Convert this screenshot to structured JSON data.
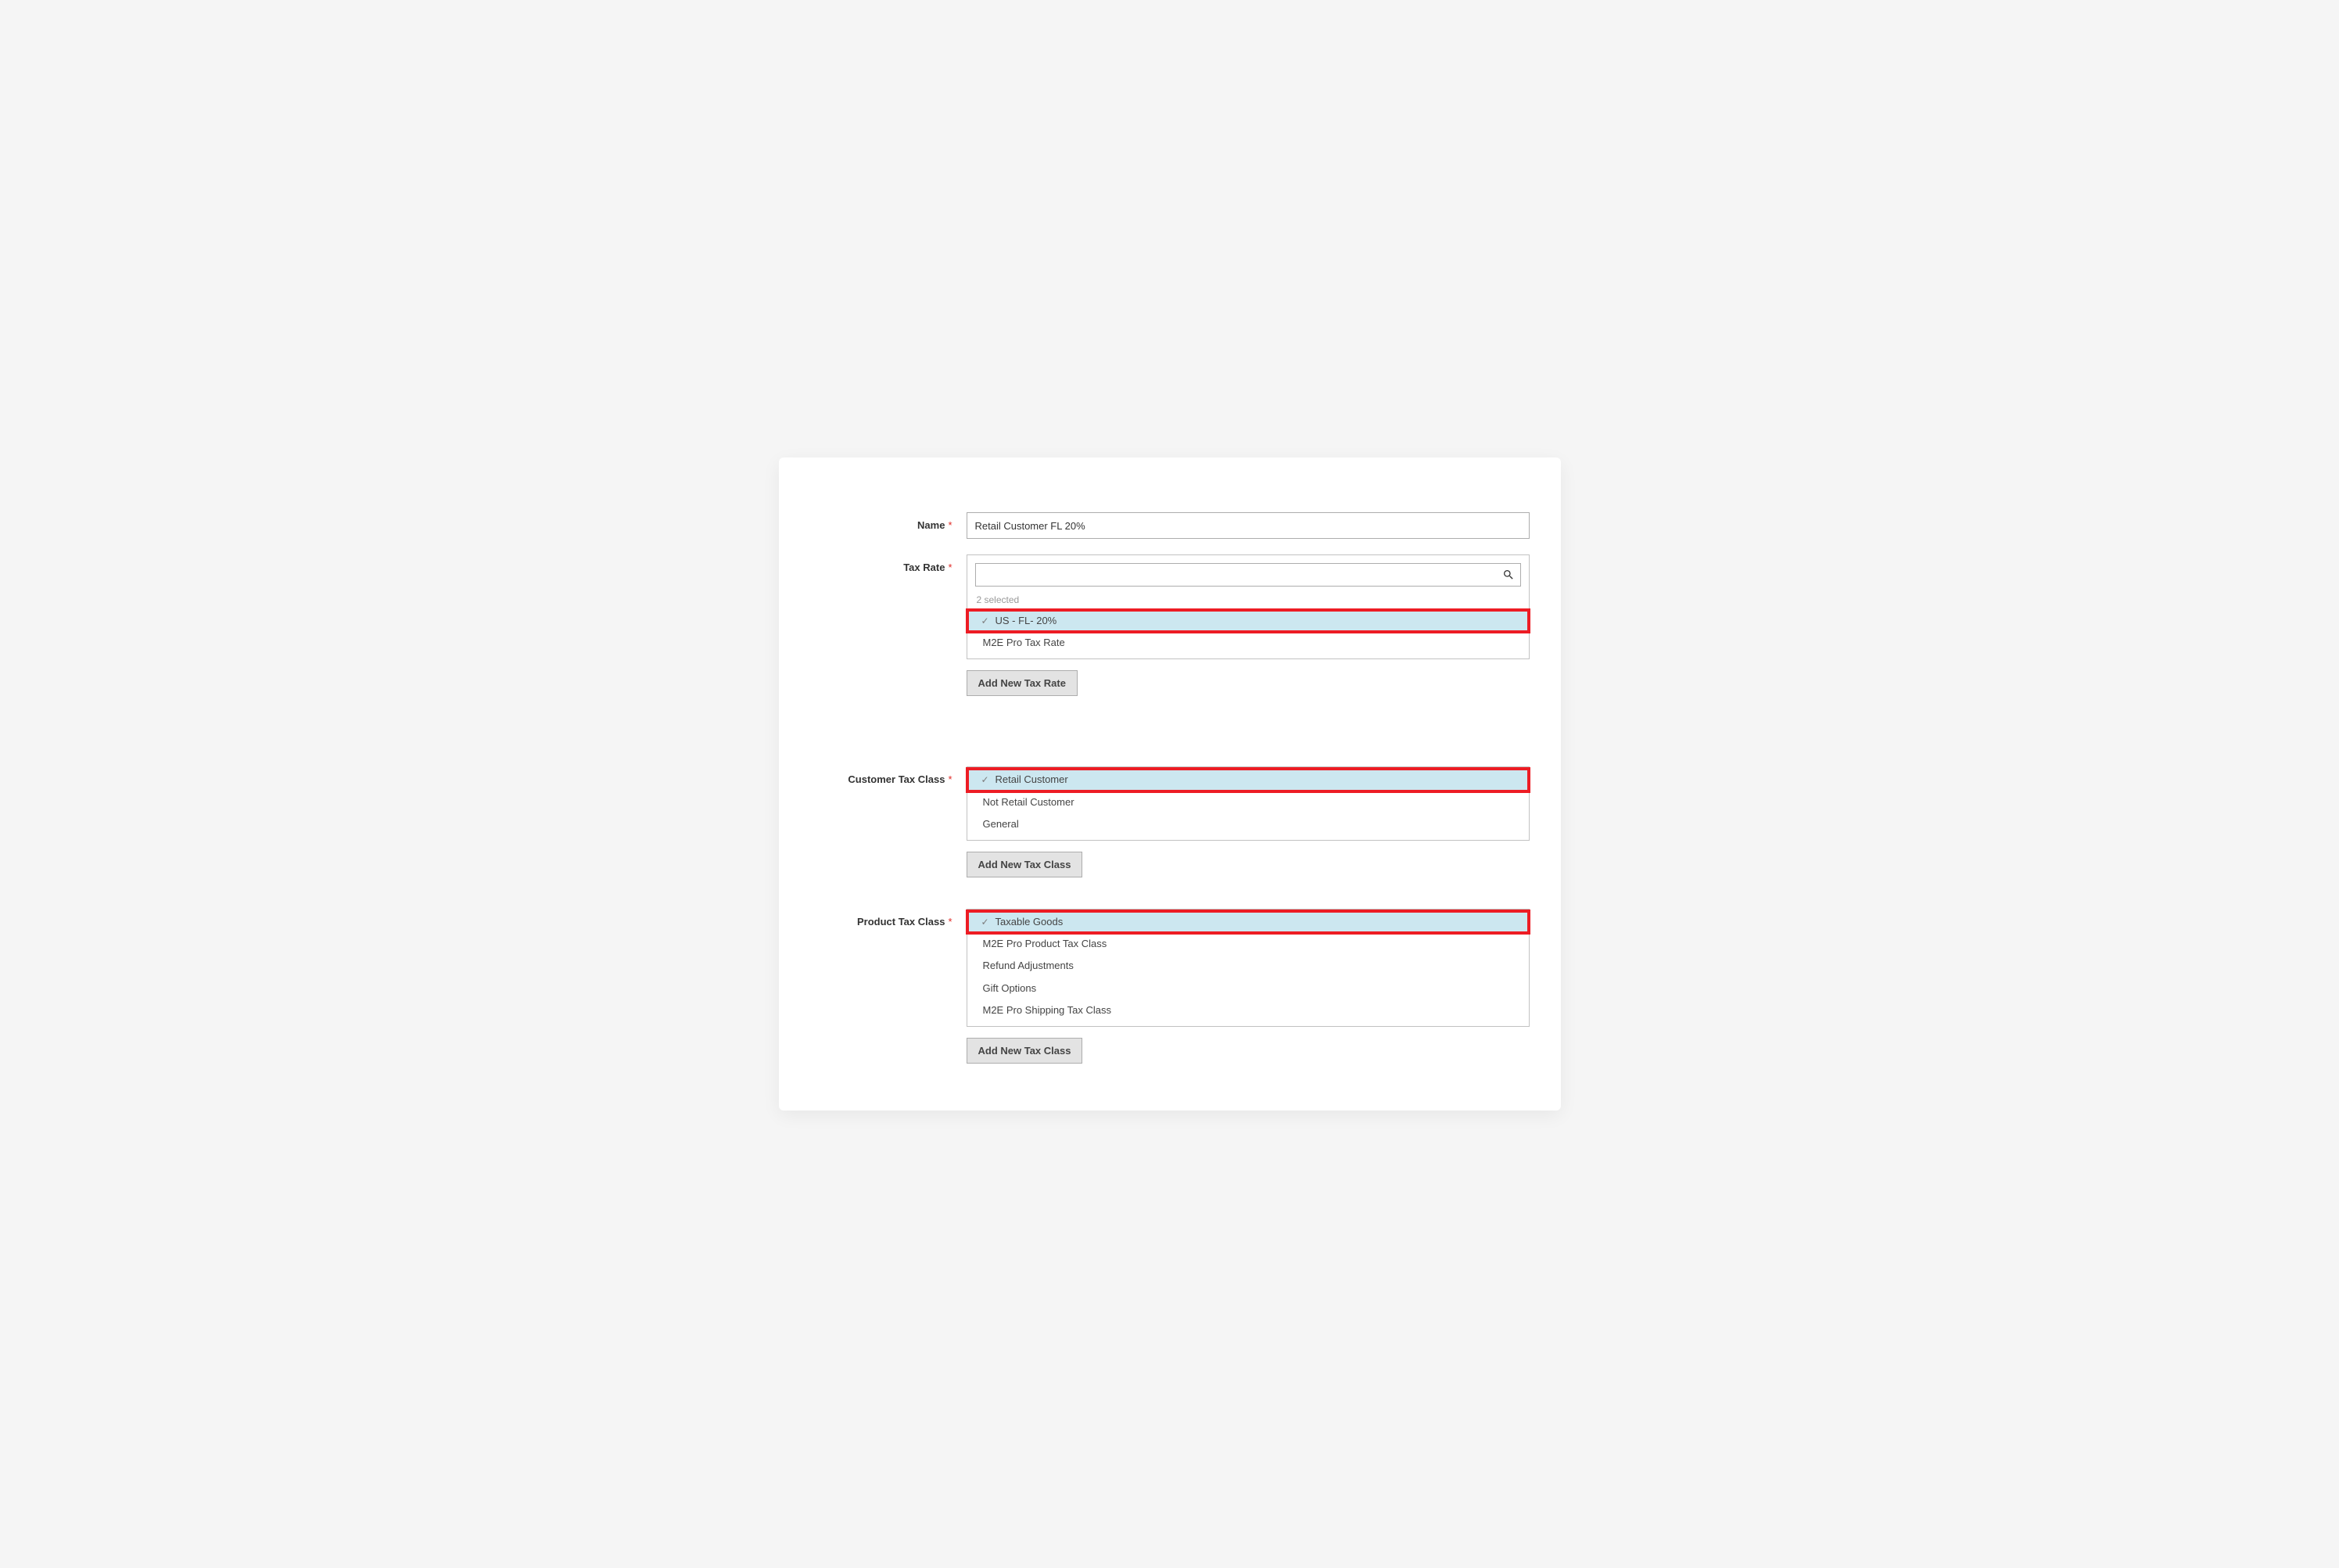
{
  "name": {
    "label": "Name",
    "value": "Retail Customer FL 20%"
  },
  "taxRate": {
    "label": "Tax Rate",
    "searchPlaceholder": "",
    "selectedCount": "2 selected",
    "options": [
      {
        "label": "US - FL- 20%",
        "selected": true,
        "highlighted": true
      },
      {
        "label": "M2E Pro Tax Rate",
        "selected": false,
        "highlighted": false
      }
    ],
    "addButton": "Add New Tax Rate"
  },
  "customerTaxClass": {
    "label": "Customer Tax Class",
    "options": [
      {
        "label": "Retail Customer",
        "selected": true,
        "highlighted": true
      },
      {
        "label": "Not Retail Customer",
        "selected": false,
        "highlighted": false
      },
      {
        "label": "General",
        "selected": false,
        "highlighted": false
      }
    ],
    "addButton": "Add New Tax Class"
  },
  "productTaxClass": {
    "label": "Product Tax Class",
    "options": [
      {
        "label": "Taxable Goods",
        "selected": true,
        "highlighted": true
      },
      {
        "label": "M2E Pro Product Tax Class",
        "selected": false,
        "highlighted": false
      },
      {
        "label": "Refund Adjustments",
        "selected": false,
        "highlighted": false
      },
      {
        "label": "Gift Options",
        "selected": false,
        "highlighted": false
      },
      {
        "label": "M2E Pro Shipping Tax Class",
        "selected": false,
        "highlighted": false
      }
    ],
    "addButton": "Add New Tax Class"
  }
}
